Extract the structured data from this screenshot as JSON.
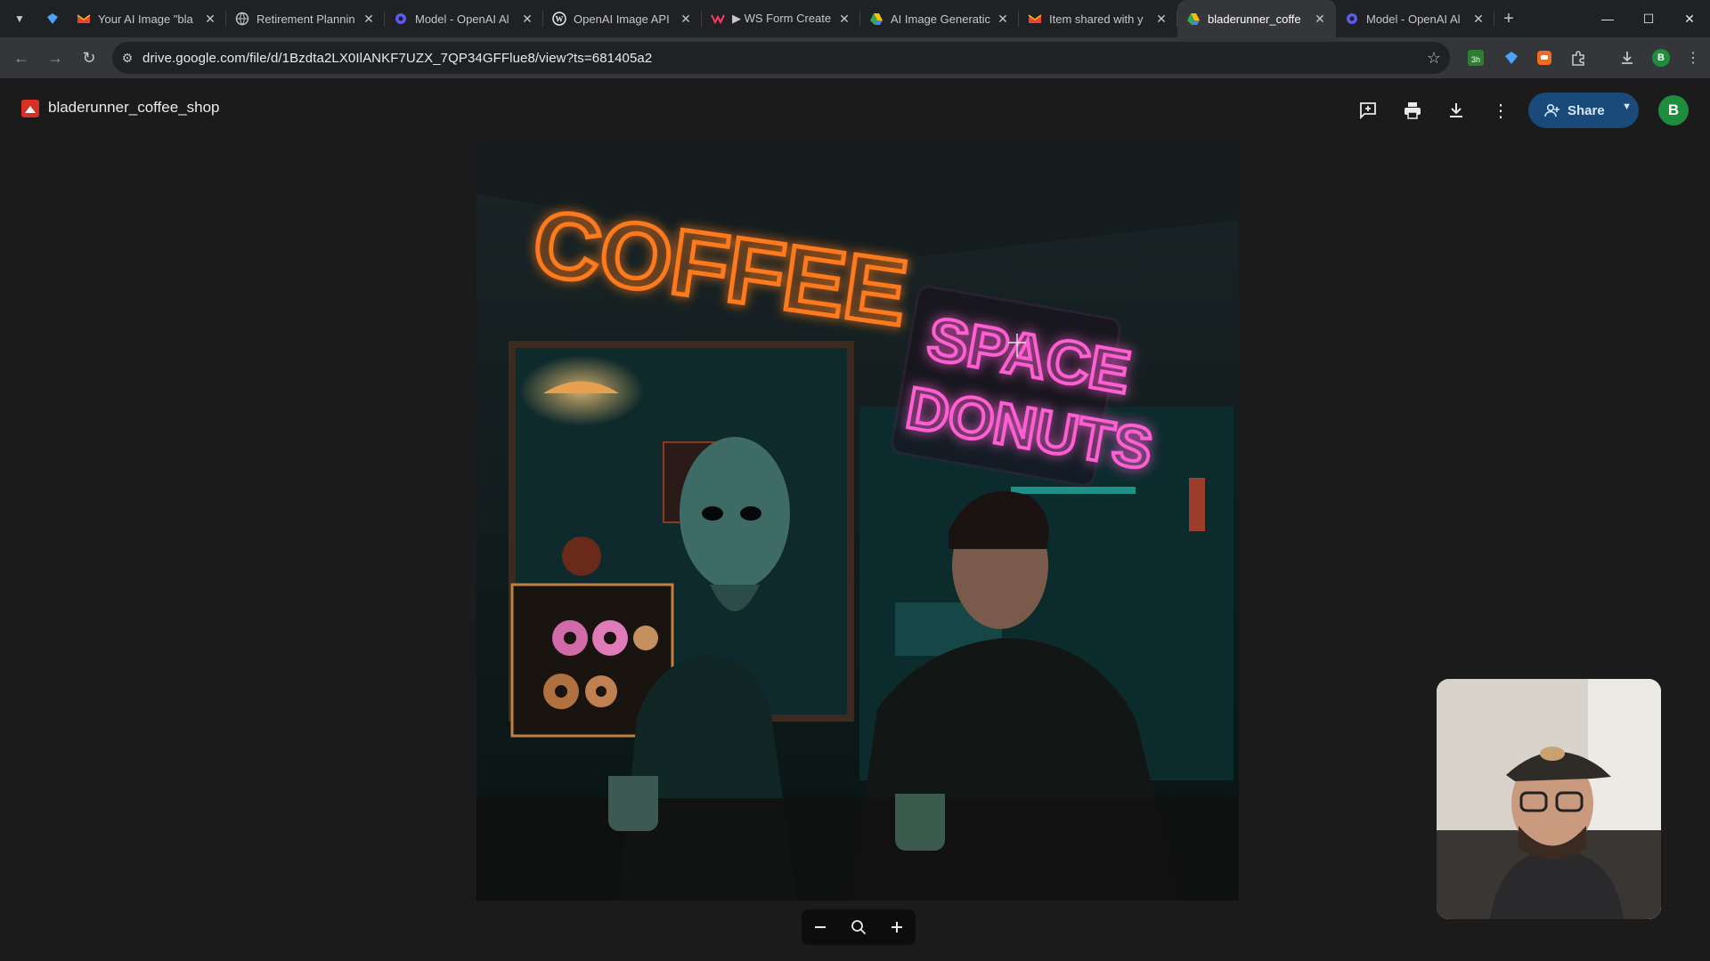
{
  "browser": {
    "tabs": [
      {
        "title": "Your AI Image \"bla",
        "icon": "gmail-icon",
        "active": false
      },
      {
        "title": "Retirement Plannin",
        "icon": "globe-icon",
        "active": false
      },
      {
        "title": "Model - OpenAI Al",
        "icon": "openai-icon",
        "active": false
      },
      {
        "title": "OpenAI Image API",
        "icon": "wordpress-icon",
        "active": false
      },
      {
        "title": "▶ WS Form Create",
        "icon": "wsform-icon",
        "active": false
      },
      {
        "title": "AI Image Generatic",
        "icon": "drive-icon",
        "active": false
      },
      {
        "title": "Item shared with y",
        "icon": "gmail-icon",
        "active": false
      },
      {
        "title": "bladerunner_coffe",
        "icon": "drive-icon",
        "active": true
      },
      {
        "title": "Model - OpenAI Al",
        "icon": "openai-icon",
        "active": false
      }
    ],
    "url": "drive.google.com/file/d/1Bzdta2LX0IlANKF7UZX_7QP34GFFlue8/view?ts=681405a2",
    "profile_initial": "B",
    "extension_badge": "3h"
  },
  "drive": {
    "file_name": "bladerunner_coffee_shop",
    "share_label": "Share",
    "avatar_initial": "B"
  },
  "image_text": {
    "sign_coffee": "COFFEE",
    "sign_space": "SPACE",
    "sign_donuts": "DONUTS"
  },
  "colors": {
    "share_button": "#1a4a7a",
    "avatar": "#1e8e3e",
    "neon_orange": "#ff7a1a",
    "neon_pink": "#ff5fd2"
  }
}
